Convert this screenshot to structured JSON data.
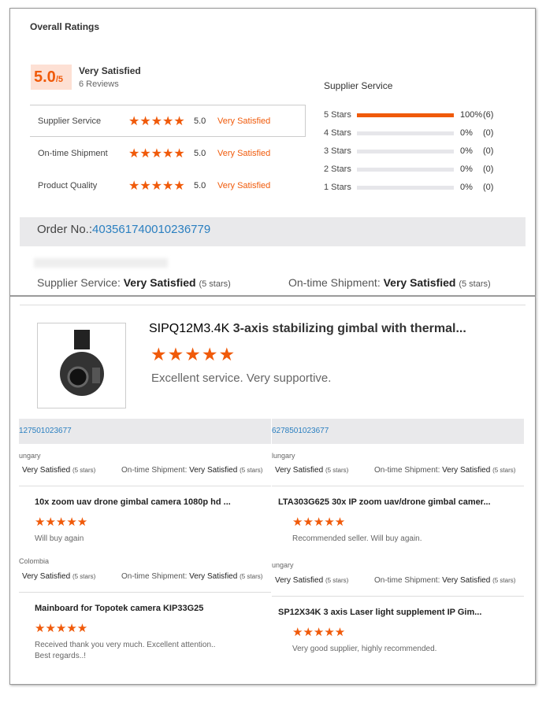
{
  "overall": {
    "title": "Overall Ratings",
    "score": "5.0",
    "out_of": "/5",
    "label": "Very Satisfied",
    "reviews": "6 Reviews",
    "rows": [
      {
        "name": "Supplier Service",
        "score": "5.0",
        "label": "Very Satisfied"
      },
      {
        "name": "On-time Shipment",
        "score": "5.0",
        "label": "Very Satisfied"
      },
      {
        "name": "Product Quality",
        "score": "5.0",
        "label": "Very Satisfied"
      }
    ],
    "distribution_title": "Supplier Service",
    "distribution": [
      {
        "label": "5 Stars",
        "percent": 100,
        "pct_text": "100%",
        "count": "(6)"
      },
      {
        "label": "4 Stars",
        "percent": 0,
        "pct_text": "0%",
        "count": "(0)"
      },
      {
        "label": "3 Stars",
        "percent": 0,
        "pct_text": "0%",
        "count": "(0)"
      },
      {
        "label": "2 Stars",
        "percent": 0,
        "pct_text": "0%",
        "count": "(0)"
      },
      {
        "label": "1 Stars",
        "percent": 0,
        "pct_text": "0%",
        "count": "(0)"
      }
    ]
  },
  "order": {
    "label": "Order No.:",
    "number": "403561740010236779",
    "ss_label": "Supplier Service: ",
    "ss_value": "Very Satisfied",
    "ss_stars": "(5 stars)",
    "os_label": "On-time Shipment: ",
    "os_value": "Very Satisfied",
    "os_stars": "(5 stars)"
  },
  "main_review": {
    "title_model": "SIPQ12M3.4K",
    "title_rest": " 3-axis stabilizing gimbal with thermal...",
    "comment": "Excellent service. Very supportive."
  },
  "cards": [
    {
      "order": "127501023677",
      "country": "ungary",
      "ss": "Very Satisfied",
      "ss_stars": "(5 stars)",
      "os_label": "On-time Shipment: ",
      "os": "Very Satisfied",
      "os_stars": "(5 stars)",
      "product": "10x zoom uav drone gimbal camera 1080p hd ...",
      "comment": "Will buy again"
    },
    {
      "order": "6278501023677",
      "country": "lungary",
      "ss": "Very Satisfied",
      "ss_stars": "(5 stars)",
      "os_label": "On-time Shipment: ",
      "os": "Very Satisfied",
      "os_stars": "(5 stars)",
      "product": "LTA303G625 30x IP zoom uav/drone gimbal camer...",
      "comment": "Recommended seller. Will buy again."
    },
    {
      "country": "Colombia",
      "ss": "Very Satisfied",
      "ss_stars": "(5 stars)",
      "os_label": "On-time Shipment: ",
      "os": "Very Satisfied",
      "os_stars": "(5 stars)",
      "product": "Mainboard for Topotek camera  KIP33G25",
      "comment": "Received thank you very much. Excellent attention.. Best regards..!"
    },
    {
      "country": "ungary",
      "ss": "Very Satisfied",
      "ss_stars": "(5 stars)",
      "os_label": "On-time Shipment: ",
      "os": "Very Satisfied",
      "os_stars": "(5 stars)",
      "product": "SP12X34K 3 axis Laser light supplement IP Gim...",
      "comment": "Very good supplier, highly recommended."
    }
  ],
  "stars": "★★★★★",
  "colors": {
    "accent": "#f05a0a",
    "link": "#2a7fc0"
  }
}
